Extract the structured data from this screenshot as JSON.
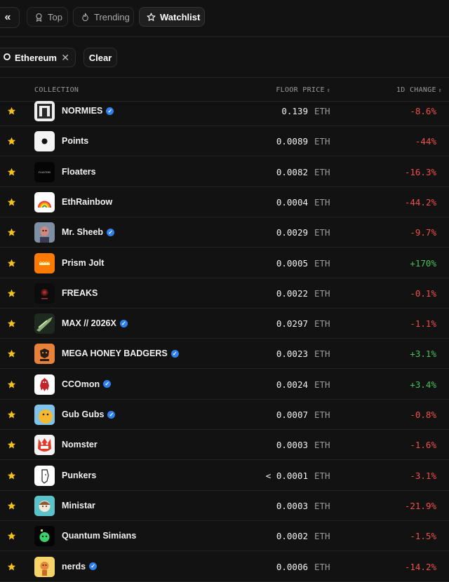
{
  "nav": {
    "collapse_icon": "double-chevron-left-icon",
    "tabs": [
      {
        "label": "Top",
        "icon": "award-icon",
        "active": false
      },
      {
        "label": "Trending",
        "icon": "flame-icon",
        "active": false
      },
      {
        "label": "Watchlist",
        "icon": "star-icon",
        "active": true
      }
    ]
  },
  "filters": {
    "chip": {
      "label": "Ethereum",
      "icon": "ethereum-icon",
      "remove_icon": "close-icon"
    },
    "clear_label": "Clear"
  },
  "table": {
    "headers": {
      "collection": "COLLECTION",
      "floor_price": "FLOOR PRICE",
      "change": "1D CHANGE"
    },
    "rows": [
      {
        "name": "NORMIES",
        "verified": true,
        "price": "0.139",
        "unit": "ETH",
        "change": "-8.6%",
        "dir": "neg"
      },
      {
        "name": "Points",
        "verified": false,
        "price": "0.0089",
        "unit": "ETH",
        "change": "-44%",
        "dir": "neg"
      },
      {
        "name": "Floaters",
        "verified": false,
        "price": "0.0082",
        "unit": "ETH",
        "change": "-16.3%",
        "dir": "neg"
      },
      {
        "name": "EthRainbow",
        "verified": false,
        "price": "0.0004",
        "unit": "ETH",
        "change": "-44.2%",
        "dir": "neg"
      },
      {
        "name": "Mr. Sheeb",
        "verified": true,
        "price": "0.0029",
        "unit": "ETH",
        "change": "-9.7%",
        "dir": "neg"
      },
      {
        "name": "Prism Jolt",
        "verified": false,
        "price": "0.0005",
        "unit": "ETH",
        "change": "+170%",
        "dir": "pos"
      },
      {
        "name": "FREAKS",
        "verified": false,
        "price": "0.0022",
        "unit": "ETH",
        "change": "-0.1%",
        "dir": "neg"
      },
      {
        "name": "MAX // 2026X",
        "verified": true,
        "price": "0.0297",
        "unit": "ETH",
        "change": "-1.1%",
        "dir": "neg"
      },
      {
        "name": "MEGA HONEY BADGERS",
        "verified": true,
        "price": "0.0023",
        "unit": "ETH",
        "change": "+3.1%",
        "dir": "pos"
      },
      {
        "name": "CCOmon",
        "verified": true,
        "price": "0.0024",
        "unit": "ETH",
        "change": "+3.4%",
        "dir": "pos"
      },
      {
        "name": "Gub Gubs",
        "verified": true,
        "price": "0.0007",
        "unit": "ETH",
        "change": "-0.8%",
        "dir": "neg"
      },
      {
        "name": "Nomster",
        "verified": false,
        "price": "0.0003",
        "unit": "ETH",
        "change": "-1.6%",
        "dir": "neg"
      },
      {
        "name": "Punkers",
        "verified": false,
        "price": "< 0.0001",
        "unit": "ETH",
        "change": "-3.1%",
        "dir": "neg"
      },
      {
        "name": "Ministar",
        "verified": false,
        "price": "0.0003",
        "unit": "ETH",
        "change": "-21.9%",
        "dir": "neg"
      },
      {
        "name": "Quantum Simians",
        "verified": false,
        "price": "0.0002",
        "unit": "ETH",
        "change": "-1.5%",
        "dir": "neg"
      },
      {
        "name": "nerds",
        "verified": true,
        "price": "0.0006",
        "unit": "ETH",
        "change": "-14.2%",
        "dir": "neg"
      }
    ]
  },
  "colors": {
    "negative": "#f0504a",
    "positive": "#46c15a",
    "star": "#f2c21b",
    "verified": "#2f80ed"
  }
}
